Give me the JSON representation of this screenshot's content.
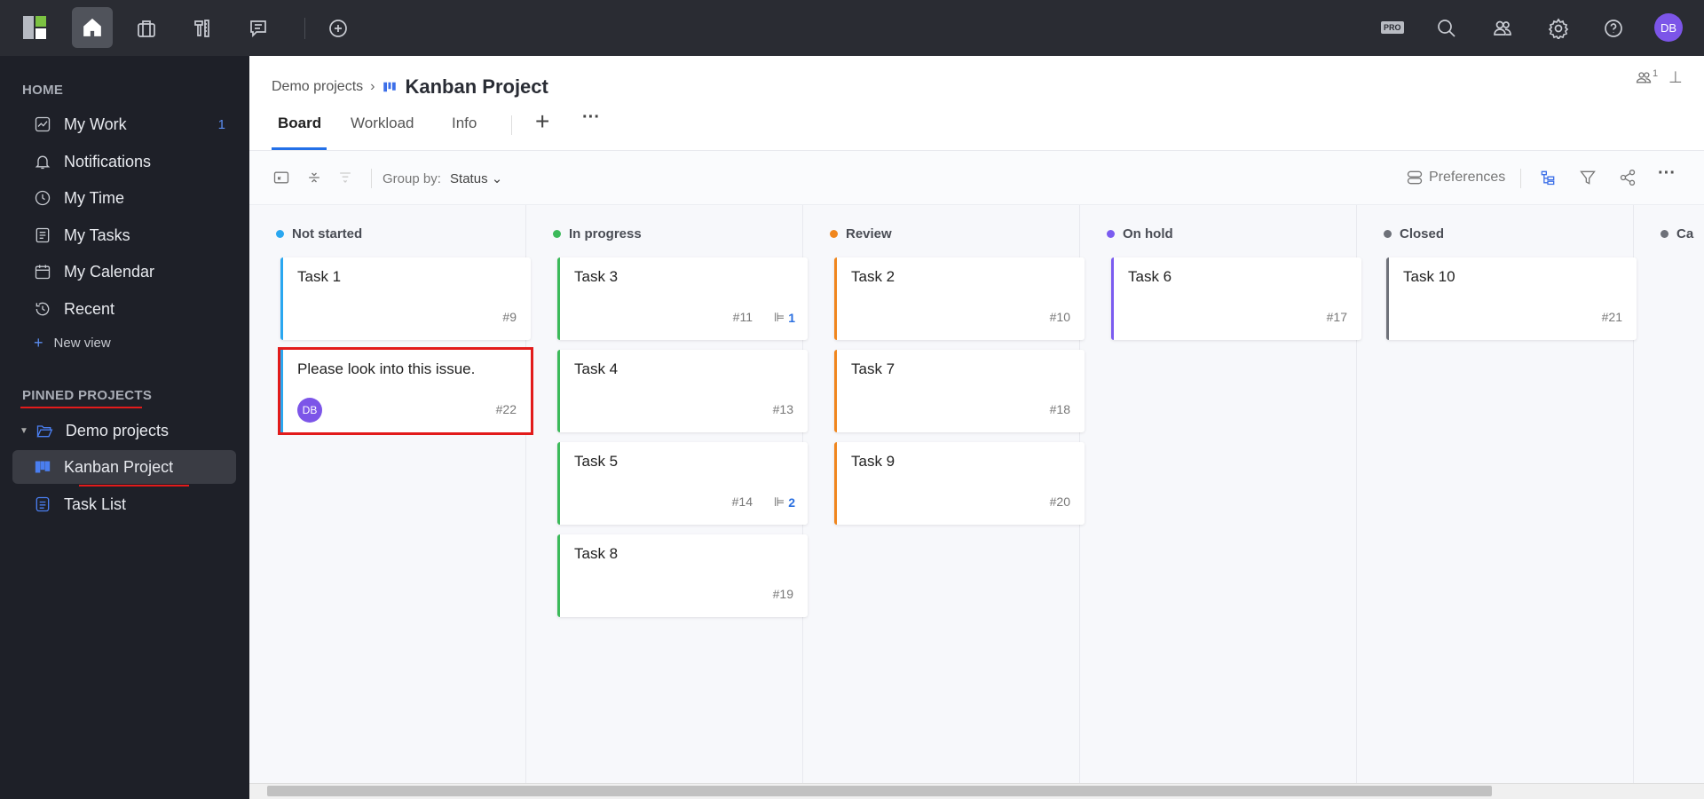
{
  "topbar": {
    "icons": [
      "app-logo",
      "home-icon",
      "briefcase-icon",
      "tools-icon",
      "chat-icon",
      "plus-circle-icon"
    ],
    "pro_badge": "PRO",
    "avatar": "DB",
    "accent": "#7c55e8"
  },
  "sidebar": {
    "home_heading": "HOME",
    "items": [
      {
        "label": "My Work",
        "count": "1",
        "icon": "chart-icon"
      },
      {
        "label": "Notifications",
        "icon": "bell-icon"
      },
      {
        "label": "My Time",
        "icon": "clock-icon"
      },
      {
        "label": "My Tasks",
        "icon": "tasks-icon"
      },
      {
        "label": "My Calendar",
        "icon": "calendar-icon"
      },
      {
        "label": "Recent",
        "icon": "history-icon"
      }
    ],
    "new_view": "New view",
    "pinned_heading": "PINNED PROJECTS",
    "folder": "Demo projects",
    "projects": [
      {
        "label": "Kanban Project",
        "active": true
      },
      {
        "label": "Task List"
      }
    ]
  },
  "header": {
    "breadcrumb": "Demo projects",
    "title": "Kanban Project",
    "members_count": "1",
    "tabs": [
      "Board",
      "Workload",
      "Info"
    ]
  },
  "toolbar": {
    "group_by_label": "Group by:",
    "group_by_value": "Status",
    "preferences": "Preferences"
  },
  "board": {
    "columns": [
      {
        "name": "Not started",
        "color": "#2aa7f0",
        "cards": [
          {
            "title": "Task 1",
            "id": "#9"
          },
          {
            "title": "Please look into this issue.",
            "id": "#22",
            "assignee": "DB",
            "highlighted": true
          }
        ]
      },
      {
        "name": "In progress",
        "color": "#3cba5a",
        "cards": [
          {
            "title": "Task 3",
            "id": "#11",
            "subtasks": "1"
          },
          {
            "title": "Task 4",
            "id": "#13"
          },
          {
            "title": "Task 5",
            "id": "#14",
            "subtasks": "2"
          },
          {
            "title": "Task 8",
            "id": "#19"
          }
        ]
      },
      {
        "name": "Review",
        "color": "#f0861d",
        "cards": [
          {
            "title": "Task 2",
            "id": "#10"
          },
          {
            "title": "Task 7",
            "id": "#18"
          },
          {
            "title": "Task 9",
            "id": "#20"
          }
        ]
      },
      {
        "name": "On hold",
        "color": "#7b5cf0",
        "cards": [
          {
            "title": "Task 6",
            "id": "#17"
          }
        ]
      },
      {
        "name": "Closed",
        "color": "#6e7179",
        "cards": [
          {
            "title": "Task 10",
            "id": "#21"
          }
        ]
      },
      {
        "name": "Ca",
        "color": "#6e7179",
        "cards": []
      }
    ]
  }
}
